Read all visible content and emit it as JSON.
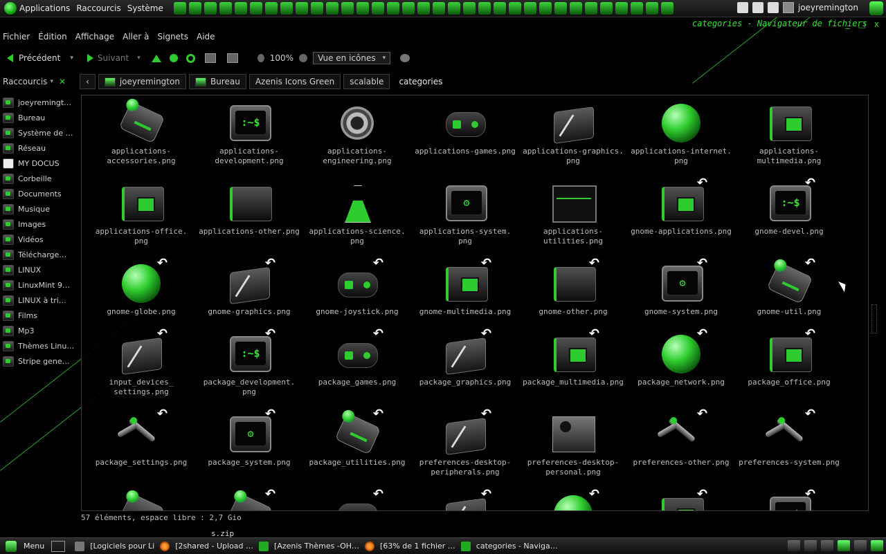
{
  "top_panel": {
    "menus": [
      "Applications",
      "Raccourcis",
      "Système"
    ],
    "username": "joeyremington"
  },
  "window": {
    "title": "categories - Navigateur de fichiers",
    "controls": [
      "_",
      "□",
      "x"
    ]
  },
  "menubar": [
    "Fichier",
    "Édition",
    "Affichage",
    "Aller à",
    "Signets",
    "Aide"
  ],
  "toolbar": {
    "back": "Précédent",
    "forward": "Suivant",
    "zoom": "100%",
    "view_mode": "Vue en icônes"
  },
  "location": {
    "sidebar_mode": "Raccourcis",
    "crumbs": [
      "joeyremington",
      "Bureau",
      "Azenis Icons Green",
      "scalable",
      "categories"
    ]
  },
  "sidebar": [
    {
      "label": "joeyremingt…",
      "icon": "home-icon"
    },
    {
      "label": "Bureau",
      "icon": "desktop-icon"
    },
    {
      "label": "Système de …",
      "icon": "drive-icon"
    },
    {
      "label": "Réseau",
      "icon": "network-icon"
    },
    {
      "label": "MY DOCUS",
      "icon": "document-icon"
    },
    {
      "label": "Corbeille",
      "icon": "trash-icon"
    },
    {
      "label": "Documents",
      "icon": "folder-icon"
    },
    {
      "label": "Musique",
      "icon": "folder-icon"
    },
    {
      "label": "Images",
      "icon": "folder-icon"
    },
    {
      "label": "Vidéos",
      "icon": "folder-icon"
    },
    {
      "label": "Télécharge…",
      "icon": "folder-icon"
    },
    {
      "label": "LINUX",
      "icon": "folder-icon"
    },
    {
      "label": "LinuxMint 9…",
      "icon": "folder-icon"
    },
    {
      "label": "LINUX à tri…",
      "icon": "folder-icon"
    },
    {
      "label": "Films",
      "icon": "folder-icon"
    },
    {
      "label": "Mp3",
      "icon": "folder-icon"
    },
    {
      "label": "Thèmes Linu…",
      "icon": "folder-icon"
    },
    {
      "label": "Stripe gene…",
      "icon": "folder-icon"
    }
  ],
  "files": [
    {
      "name": "applications-accessories.png",
      "lines": [
        "applications-",
        "accessories.png"
      ],
      "art": "cam",
      "link": false
    },
    {
      "name": "applications-development.png",
      "lines": [
        "applications-",
        "development.png"
      ],
      "art": "term",
      "link": false
    },
    {
      "name": "applications-engineering.png",
      "lines": [
        "applications-",
        "engineering.png"
      ],
      "art": "gear",
      "link": false
    },
    {
      "name": "applications-games.png",
      "lines": [
        "applications-games.png"
      ],
      "art": "pad",
      "link": false
    },
    {
      "name": "applications-graphics.png",
      "lines": [
        "applications-graphics.",
        "png"
      ],
      "art": "tab",
      "link": false
    },
    {
      "name": "applications-internet.png",
      "lines": [
        "applications-internet.",
        "png"
      ],
      "art": "globe",
      "link": false
    },
    {
      "name": "applications-multimedia.png",
      "lines": [
        "applications-",
        "multimedia.png"
      ],
      "art": "folder",
      "link": false
    },
    {
      "name": "applications-office.png",
      "lines": [
        "applications-office.",
        "png"
      ],
      "art": "folder",
      "link": false
    },
    {
      "name": "applications-other.png",
      "lines": [
        "applications-other.png"
      ],
      "art": "folderplain",
      "link": false
    },
    {
      "name": "applications-science.png",
      "lines": [
        "applications-science.",
        "png"
      ],
      "art": "flask",
      "link": false
    },
    {
      "name": "applications-system.png",
      "lines": [
        "applications-system.",
        "png"
      ],
      "art": "termgear",
      "link": false
    },
    {
      "name": "applications-utilities.png",
      "lines": [
        "applications-",
        "utilities.png"
      ],
      "art": "chart",
      "link": false
    },
    {
      "name": "gnome-applications.png",
      "lines": [
        "gnome-applications.png"
      ],
      "art": "folder",
      "link": true
    },
    {
      "name": "gnome-devel.png",
      "lines": [
        "gnome-devel.png"
      ],
      "art": "term",
      "link": true
    },
    {
      "name": "gnome-globe.png",
      "lines": [
        "gnome-globe.png"
      ],
      "art": "globe",
      "link": true
    },
    {
      "name": "gnome-graphics.png",
      "lines": [
        "gnome-graphics.png"
      ],
      "art": "tab",
      "link": true
    },
    {
      "name": "gnome-joystick.png",
      "lines": [
        "gnome-joystick.png"
      ],
      "art": "pad",
      "link": true
    },
    {
      "name": "gnome-multimedia.png",
      "lines": [
        "gnome-multimedia.png"
      ],
      "art": "folder",
      "link": true
    },
    {
      "name": "gnome-other.png",
      "lines": [
        "gnome-other.png"
      ],
      "art": "folderplain",
      "link": true
    },
    {
      "name": "gnome-system.png",
      "lines": [
        "gnome-system.png"
      ],
      "art": "termgear",
      "link": true
    },
    {
      "name": "gnome-util.png",
      "lines": [
        "gnome-util.png"
      ],
      "art": "cam",
      "link": true
    },
    {
      "name": "input_devices_settings.png",
      "lines": [
        "input_devices_",
        "settings.png"
      ],
      "art": "tab",
      "link": true
    },
    {
      "name": "package_development.png",
      "lines": [
        "package_development.",
        "png"
      ],
      "art": "term",
      "link": true
    },
    {
      "name": "package_games.png",
      "lines": [
        "package_games.png"
      ],
      "art": "pad",
      "link": true
    },
    {
      "name": "package_graphics.png",
      "lines": [
        "package_graphics.png"
      ],
      "art": "tab",
      "link": true
    },
    {
      "name": "package_multimedia.png",
      "lines": [
        "package_multimedia.png"
      ],
      "art": "folder",
      "link": true
    },
    {
      "name": "package_network.png",
      "lines": [
        "package_network.png"
      ],
      "art": "globe",
      "link": true
    },
    {
      "name": "package_office.png",
      "lines": [
        "package_office.png"
      ],
      "art": "folder",
      "link": true
    },
    {
      "name": "package_settings.png",
      "lines": [
        "package_settings.png"
      ],
      "art": "arm",
      "link": true
    },
    {
      "name": "package_system.png",
      "lines": [
        "package_system.png"
      ],
      "art": "termgear",
      "link": true
    },
    {
      "name": "package_utilities.png",
      "lines": [
        "package_utilities.png"
      ],
      "art": "cam",
      "link": true
    },
    {
      "name": "preferences-desktop-peripherals.png",
      "lines": [
        "preferences-desktop-",
        "peripherals.png"
      ],
      "art": "tab",
      "link": true
    },
    {
      "name": "preferences-desktop-personal.png",
      "lines": [
        "preferences-desktop-",
        "personal.png"
      ],
      "art": "person",
      "link": false
    },
    {
      "name": "preferences-other.png",
      "lines": [
        "preferences-other.png"
      ],
      "art": "arm",
      "link": true
    },
    {
      "name": "preferences-system.png",
      "lines": [
        "preferences-system.png"
      ],
      "art": "arm",
      "link": true
    },
    {
      "name": "",
      "lines": [],
      "art": "cam",
      "link": false
    },
    {
      "name": "",
      "lines": [],
      "art": "cam",
      "link": true
    },
    {
      "name": "",
      "lines": [],
      "art": "pad",
      "link": true
    },
    {
      "name": "",
      "lines": [],
      "art": "tab",
      "link": true
    },
    {
      "name": "",
      "lines": [],
      "art": "globe",
      "link": true
    },
    {
      "name": "",
      "lines": [],
      "art": "folder",
      "link": true
    },
    {
      "name": "",
      "lines": [],
      "art": "term",
      "link": true
    }
  ],
  "status": {
    "summary": "57 éléments, espace libre : 2,7 Gio",
    "desktop_file": "s.zip"
  },
  "taskbar": {
    "menu": "Menu",
    "tasks": [
      {
        "label": "[Logiciels pour Li",
        "icon": "window-icon"
      },
      {
        "label": "[2shared - Upload …",
        "icon": "firefox-icon"
      },
      {
        "label": "[Azenis Thèmes -OH…",
        "icon": "folder-icon"
      },
      {
        "label": "[63% de 1 fichier …",
        "icon": "firefox-icon"
      },
      {
        "label": "categories - Naviga…",
        "icon": "folder-icon"
      }
    ]
  },
  "colors": {
    "accent": "#2ecc2e",
    "background": "#000000",
    "text": "#cfcfcf"
  }
}
